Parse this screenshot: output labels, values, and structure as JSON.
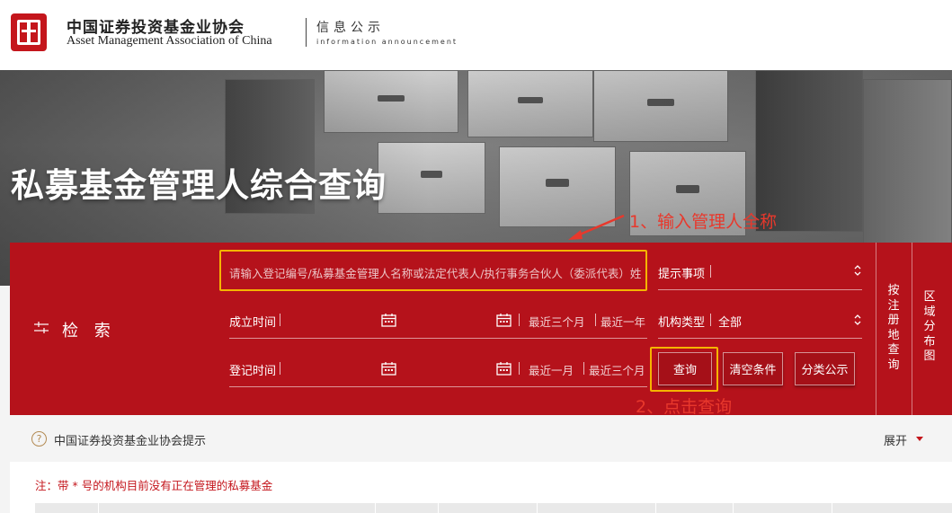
{
  "header": {
    "org_name_cn": "中国证券投资基金业协会",
    "org_name_en": "Asset Management Association of China",
    "section_cn": "信息公示",
    "section_en": "information announcement"
  },
  "banner": {
    "title": "私募基金管理人综合查询"
  },
  "annotations": {
    "step1": "1、输入管理人全称",
    "step2": "2、点击查询"
  },
  "search": {
    "label": "检 索",
    "keyword_placeholder": "请输入登记编号/私募基金管理人名称或法定代表人/执行事务合伙人（委派代表）姓",
    "tip_label": "提示事项",
    "found_date_label": "成立时间",
    "found_quick": [
      "最近三个月",
      "最近一年"
    ],
    "org_type_label": "机构类型",
    "org_type_value": "全部",
    "reg_date_label": "登记时间",
    "reg_quick": [
      "最近一月",
      "最近三个月"
    ],
    "buttons": {
      "query": "查询",
      "clear": "清空条件",
      "category": "分类公示"
    },
    "side_tabs": [
      "按注册地查询",
      "区域分布图"
    ]
  },
  "notice": {
    "text": "中国证券投资基金业协会提示",
    "expand": "展开"
  },
  "content": {
    "note": "注：带 * 号的机构目前没有正在管理的私募基金"
  },
  "colors": {
    "brand_red": "#b5121b",
    "annotation_red": "#e8382c",
    "highlight": "#f5b400"
  }
}
